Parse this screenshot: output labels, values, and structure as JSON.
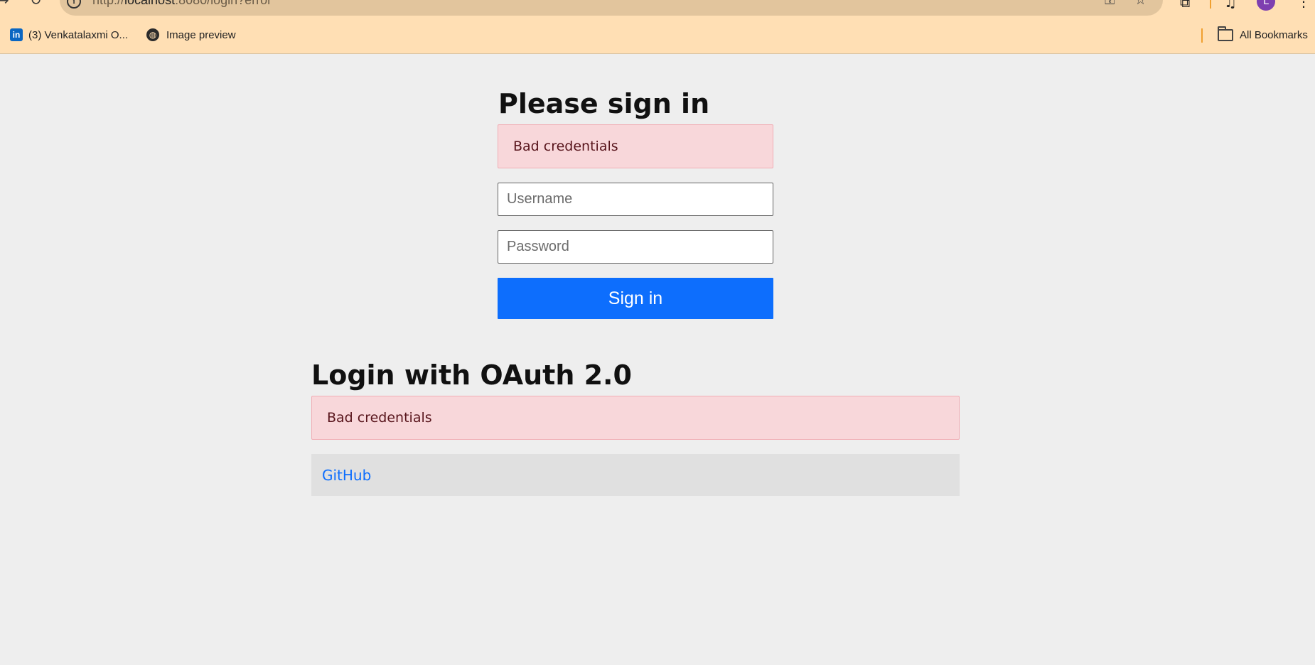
{
  "browser": {
    "url_scheme": "http://",
    "url_host": "localhost",
    "url_path": ":8080/login?error",
    "avatar_letter": "L",
    "bookmarks": [
      {
        "label": "(3) Venkatalaxmi O...",
        "icon": "linkedin-icon"
      },
      {
        "label": "Image preview",
        "icon": "globe-icon"
      }
    ],
    "all_bookmarks_label": "All Bookmarks"
  },
  "signin": {
    "heading": "Please sign in",
    "error": "Bad credentials",
    "username_placeholder": "Username",
    "password_placeholder": "Password",
    "button_label": "Sign in"
  },
  "oauth": {
    "heading": "Login with OAuth 2.0",
    "error": "Bad credentials",
    "providers": [
      {
        "label": "GitHub"
      }
    ]
  },
  "colors": {
    "toolbar_bg": "#ffdfb4",
    "page_bg": "#eeeeee",
    "alert_bg": "#f8d7da",
    "primary": "#0d6efd"
  }
}
